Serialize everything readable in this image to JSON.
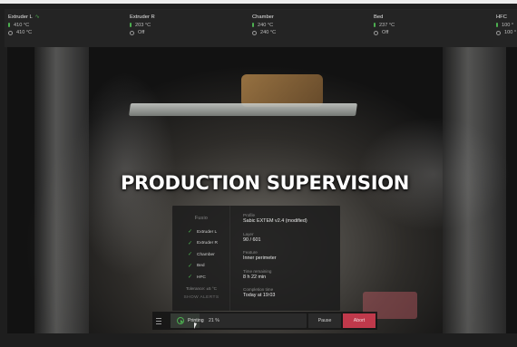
{
  "sensors": [
    {
      "name": "Extruder L",
      "current": "410 °C",
      "target": "410 °C",
      "has_wave": true
    },
    {
      "name": "Extruder R",
      "current": "203 °C",
      "target": "Off",
      "has_wave": false
    },
    {
      "name": "Chamber",
      "current": "240 °C",
      "target": "240 °C",
      "has_wave": false
    },
    {
      "name": "Bed",
      "current": "237 °C",
      "target": "Off",
      "has_wave": false
    },
    {
      "name": "HFC",
      "current": "100 °",
      "target": "100 °",
      "has_wave": false
    }
  ],
  "overlay": {
    "title": "PRODUCTION SUPERVISION"
  },
  "panel": {
    "checks_heading": "Fusio",
    "checks": [
      "Extruder L",
      "Extruder R",
      "Chamber",
      "Bed",
      "HFC"
    ],
    "tolerance": "Tolerance: ±5 °C",
    "show_alerts": "SHOW ALERTS",
    "fields": [
      {
        "label": "Profile",
        "value": "Sabic EXTEM v2.4 (modified)"
      },
      {
        "label": "Layer",
        "value": "90 / 601"
      },
      {
        "label": "Feature",
        "value": "Inner perimeter"
      },
      {
        "label": "Time remaining",
        "value": "8 h 22 min"
      },
      {
        "label": "Completion time",
        "value": "Today at 19:03"
      }
    ]
  },
  "controls": {
    "status_label": "Printing",
    "progress_text": "21 %",
    "progress_fraction": 0.21,
    "pause_label": "Pause",
    "abort_label": "Abort"
  },
  "colors": {
    "accent_green": "#4caf50",
    "abort_red": "#c0394b"
  },
  "icons": [
    "thermometer-icon",
    "target-icon",
    "wave-icon",
    "check-icon",
    "menu-icon",
    "play-icon"
  ]
}
